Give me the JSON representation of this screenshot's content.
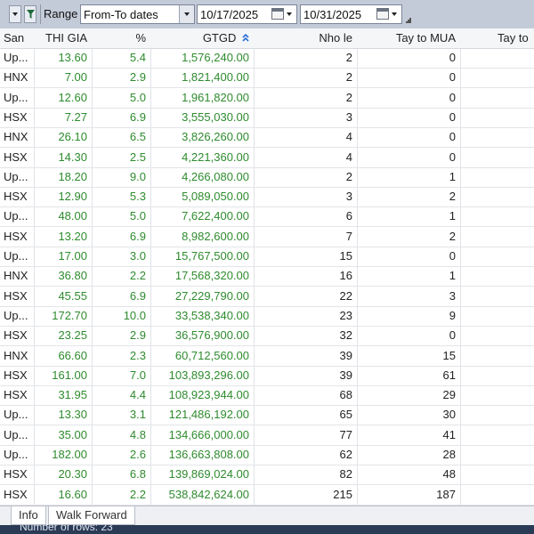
{
  "toolbar": {
    "range_label": "Range",
    "range_mode": "From-To dates",
    "from_date": "10/17/2025",
    "to_date": "10/31/2025"
  },
  "columns": [
    "San",
    "THI GIA",
    "%",
    "GTGD",
    "Nho le",
    "Tay to MUA",
    "Tay to"
  ],
  "rows": [
    {
      "san": "Up...",
      "gia": "13.60",
      "pct": "5.4",
      "gtgd": "1,576,240.00",
      "nho": "2",
      "mua": "0"
    },
    {
      "san": "HNX",
      "gia": "7.00",
      "pct": "2.9",
      "gtgd": "1,821,400.00",
      "nho": "2",
      "mua": "0"
    },
    {
      "san": "Up...",
      "gia": "12.60",
      "pct": "5.0",
      "gtgd": "1,961,820.00",
      "nho": "2",
      "mua": "0"
    },
    {
      "san": "HSX",
      "gia": "7.27",
      "pct": "6.9",
      "gtgd": "3,555,030.00",
      "nho": "3",
      "mua": "0"
    },
    {
      "san": "HNX",
      "gia": "26.10",
      "pct": "6.5",
      "gtgd": "3,826,260.00",
      "nho": "4",
      "mua": "0"
    },
    {
      "san": "HSX",
      "gia": "14.30",
      "pct": "2.5",
      "gtgd": "4,221,360.00",
      "nho": "4",
      "mua": "0"
    },
    {
      "san": "Up...",
      "gia": "18.20",
      "pct": "9.0",
      "gtgd": "4,266,080.00",
      "nho": "2",
      "mua": "1"
    },
    {
      "san": "HSX",
      "gia": "12.90",
      "pct": "5.3",
      "gtgd": "5,089,050.00",
      "nho": "3",
      "mua": "2"
    },
    {
      "san": "Up...",
      "gia": "48.00",
      "pct": "5.0",
      "gtgd": "7,622,400.00",
      "nho": "6",
      "mua": "1"
    },
    {
      "san": "HSX",
      "gia": "13.20",
      "pct": "6.9",
      "gtgd": "8,982,600.00",
      "nho": "7",
      "mua": "2"
    },
    {
      "san": "Up...",
      "gia": "17.00",
      "pct": "3.0",
      "gtgd": "15,767,500.00",
      "nho": "15",
      "mua": "0"
    },
    {
      "san": "HNX",
      "gia": "36.80",
      "pct": "2.2",
      "gtgd": "17,568,320.00",
      "nho": "16",
      "mua": "1"
    },
    {
      "san": "HSX",
      "gia": "45.55",
      "pct": "6.9",
      "gtgd": "27,229,790.00",
      "nho": "22",
      "mua": "3"
    },
    {
      "san": "Up...",
      "gia": "172.70",
      "pct": "10.0",
      "gtgd": "33,538,340.00",
      "nho": "23",
      "mua": "9"
    },
    {
      "san": "HSX",
      "gia": "23.25",
      "pct": "2.9",
      "gtgd": "36,576,900.00",
      "nho": "32",
      "mua": "0"
    },
    {
      "san": "HNX",
      "gia": "66.60",
      "pct": "2.3",
      "gtgd": "60,712,560.00",
      "nho": "39",
      "mua": "15"
    },
    {
      "san": "HSX",
      "gia": "161.00",
      "pct": "7.0",
      "gtgd": "103,893,296.00",
      "nho": "39",
      "mua": "61"
    },
    {
      "san": "HSX",
      "gia": "31.95",
      "pct": "4.4",
      "gtgd": "108,923,944.00",
      "nho": "68",
      "mua": "29"
    },
    {
      "san": "Up...",
      "gia": "13.30",
      "pct": "3.1",
      "gtgd": "121,486,192.00",
      "nho": "65",
      "mua": "30"
    },
    {
      "san": "Up...",
      "gia": "35.00",
      "pct": "4.8",
      "gtgd": "134,666,000.00",
      "nho": "77",
      "mua": "41"
    },
    {
      "san": "Up...",
      "gia": "182.00",
      "pct": "2.6",
      "gtgd": "136,663,808.00",
      "nho": "62",
      "mua": "28"
    },
    {
      "san": "HSX",
      "gia": "20.30",
      "pct": "6.8",
      "gtgd": "139,869,024.00",
      "nho": "82",
      "mua": "48"
    },
    {
      "san": "HSX",
      "gia": "16.60",
      "pct": "2.2",
      "gtgd": "538,842,624.00",
      "nho": "215",
      "mua": "187"
    }
  ],
  "tabs": [
    "Info",
    "Walk Forward"
  ],
  "status": "Number of rows: 23",
  "colors": {
    "positive": "#2e8b2e",
    "toolbar": "#c4cbd8",
    "statusbar": "#2b3a55"
  }
}
